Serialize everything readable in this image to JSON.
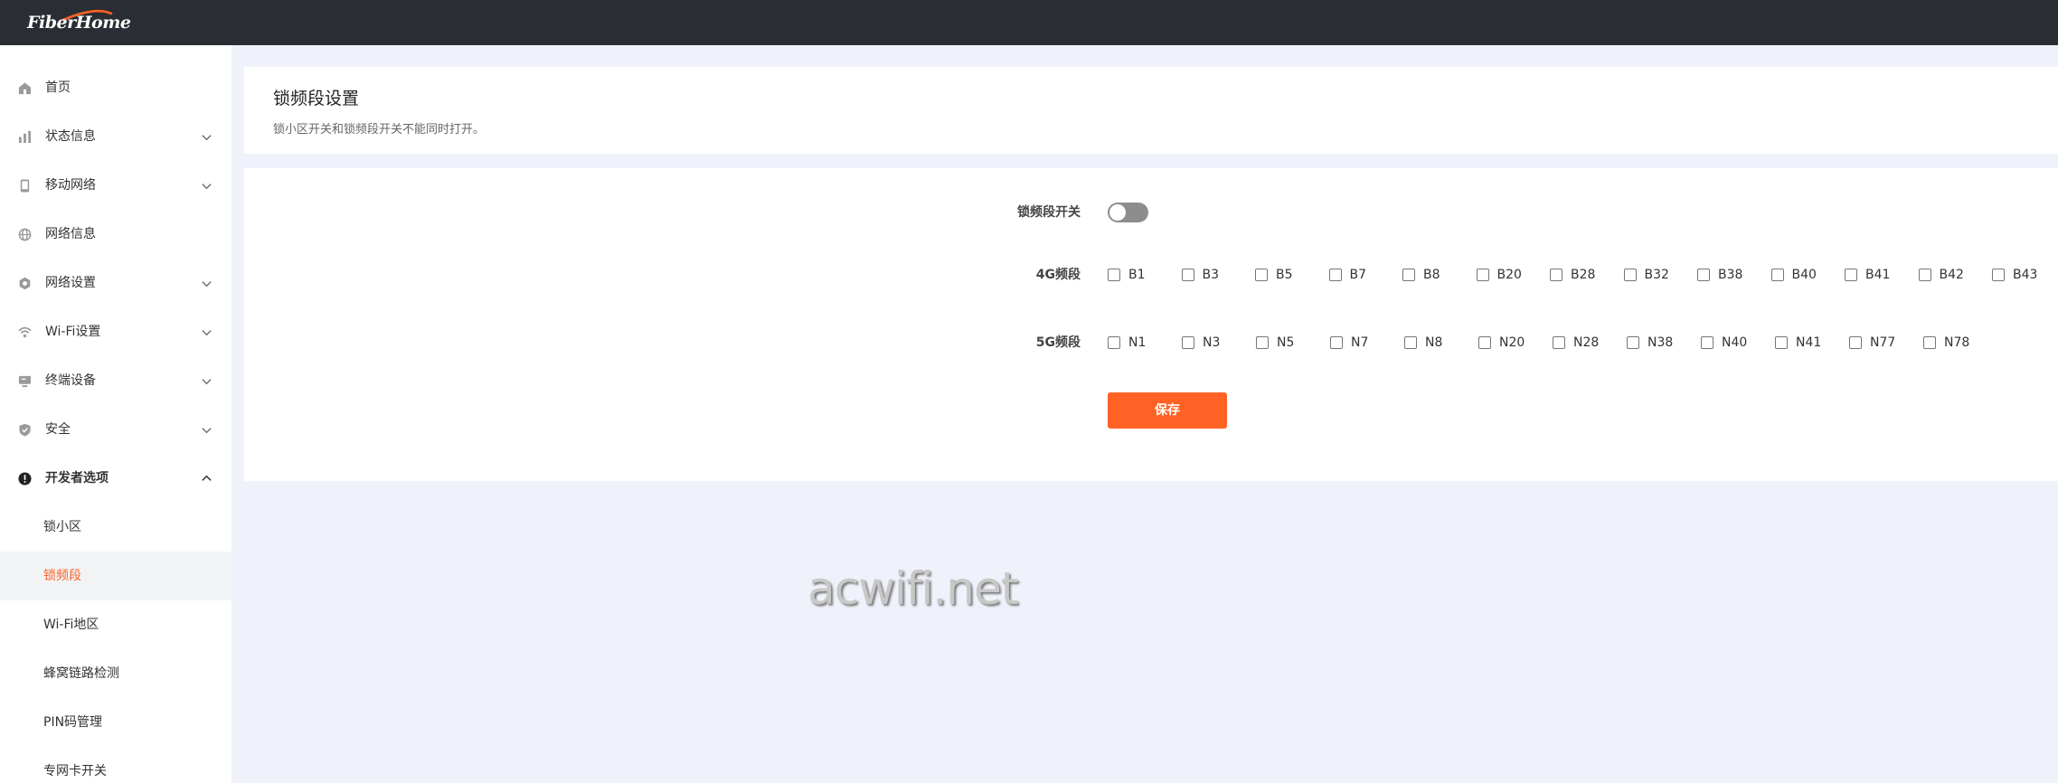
{
  "brand": {
    "logo_text": "FiberHome"
  },
  "colors": {
    "accent": "#ff6224",
    "topbar": "#2a2d33",
    "content_bg": "#eff2fa"
  },
  "sidebar": {
    "items": [
      {
        "label": "首页",
        "icon": "home-icon"
      },
      {
        "label": "状态信息",
        "icon": "bar-chart-icon"
      },
      {
        "label": "移动网络",
        "icon": "phone-icon"
      },
      {
        "label": "网络信息",
        "icon": "globe-icon"
      },
      {
        "label": "网络设置",
        "icon": "gear-icon"
      },
      {
        "label": "Wi-Fi设置",
        "icon": "wifi-icon"
      },
      {
        "label": "终端设备",
        "icon": "monitor-icon"
      },
      {
        "label": "安全",
        "icon": "shield-icon"
      },
      {
        "label": "开发者选项",
        "icon": "alert-circle-icon"
      }
    ],
    "sub_items": [
      {
        "label": "锁小区"
      },
      {
        "label": "锁频段",
        "active": true
      },
      {
        "label": "Wi-Fi地区"
      },
      {
        "label": "蜂窝链路检测"
      },
      {
        "label": "PIN码管理"
      },
      {
        "label": "专网卡开关"
      }
    ]
  },
  "header": {
    "title": "锁频段设置",
    "description": "锁小区开关和锁频段开关不能同时打开。"
  },
  "form": {
    "switch_label": "锁频段开关",
    "switch_on": false,
    "bands_4g_label": "4G频段",
    "bands_4g": [
      "B1",
      "B3",
      "B5",
      "B7",
      "B8",
      "B20",
      "B28",
      "B32",
      "B38",
      "B40",
      "B41",
      "B42",
      "B43"
    ],
    "bands_5g_label": "5G频段",
    "bands_5g": [
      "N1",
      "N3",
      "N5",
      "N7",
      "N8",
      "N20",
      "N28",
      "N38",
      "N40",
      "N41",
      "N77",
      "N78"
    ],
    "save_label": "保存"
  },
  "watermark": "acwifi.net"
}
